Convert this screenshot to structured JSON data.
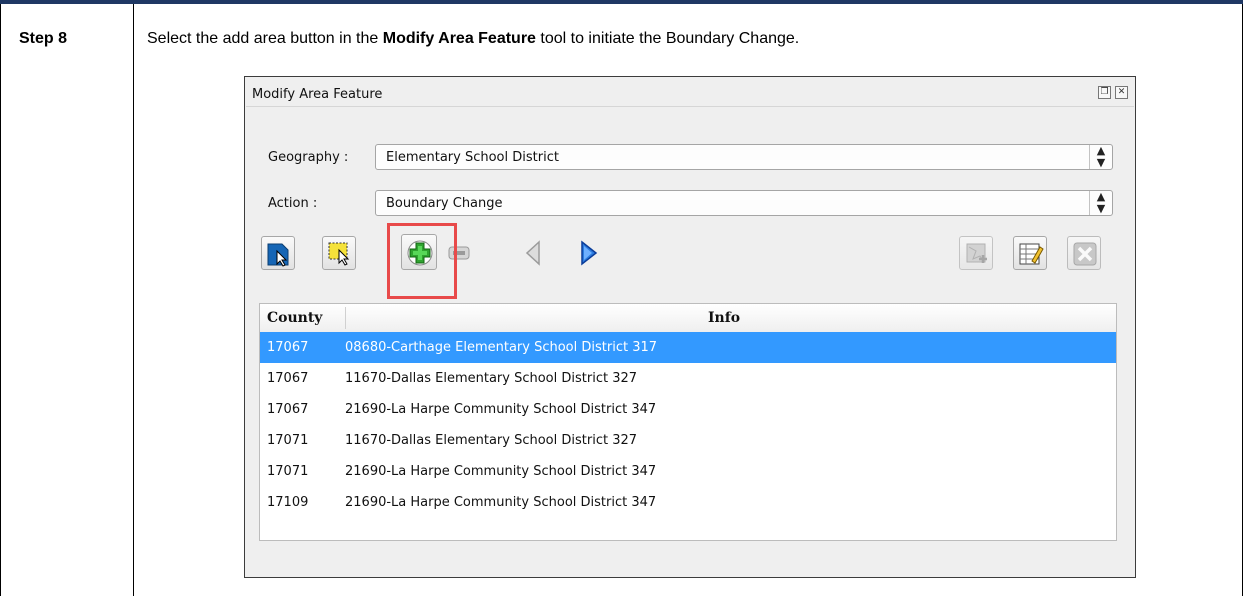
{
  "step": {
    "label": "Step 8"
  },
  "instruction": {
    "prefix": "Select the add area button in the ",
    "bold": "Modify Area Feature",
    "suffix": " tool to initiate the Boundary Change."
  },
  "dialog": {
    "title": "Modify Area Feature",
    "geography": {
      "label": "Geography :",
      "value": "Elementary School District"
    },
    "action": {
      "label": "Action :",
      "value": "Boundary Change"
    },
    "toolbar": [
      "select-feature-icon",
      "select-rectangle-icon",
      "add-area-icon",
      "remove-area-icon",
      "previous-icon",
      "next-icon",
      "map-add-icon",
      "table-edit-icon",
      "close-x-icon"
    ],
    "table": {
      "columns": [
        "County",
        "Info"
      ],
      "rows": [
        {
          "county": "17067",
          "info": "08680-Carthage Elementary School District 317",
          "selected": true
        },
        {
          "county": "17067",
          "info": "11670-Dallas Elementary School District 327",
          "selected": false
        },
        {
          "county": "17067",
          "info": "21690-La Harpe Community School District 347",
          "selected": false
        },
        {
          "county": "17071",
          "info": "11670-Dallas Elementary School District 327",
          "selected": false
        },
        {
          "county": "17071",
          "info": "21690-La Harpe Community School District 347",
          "selected": false
        },
        {
          "county": "17109",
          "info": "21690-La Harpe Community School District 347",
          "selected": false
        }
      ]
    }
  },
  "colors": {
    "highlight": "#e84a4a",
    "selection": "#3399ff",
    "topbar": "#1f3864"
  }
}
